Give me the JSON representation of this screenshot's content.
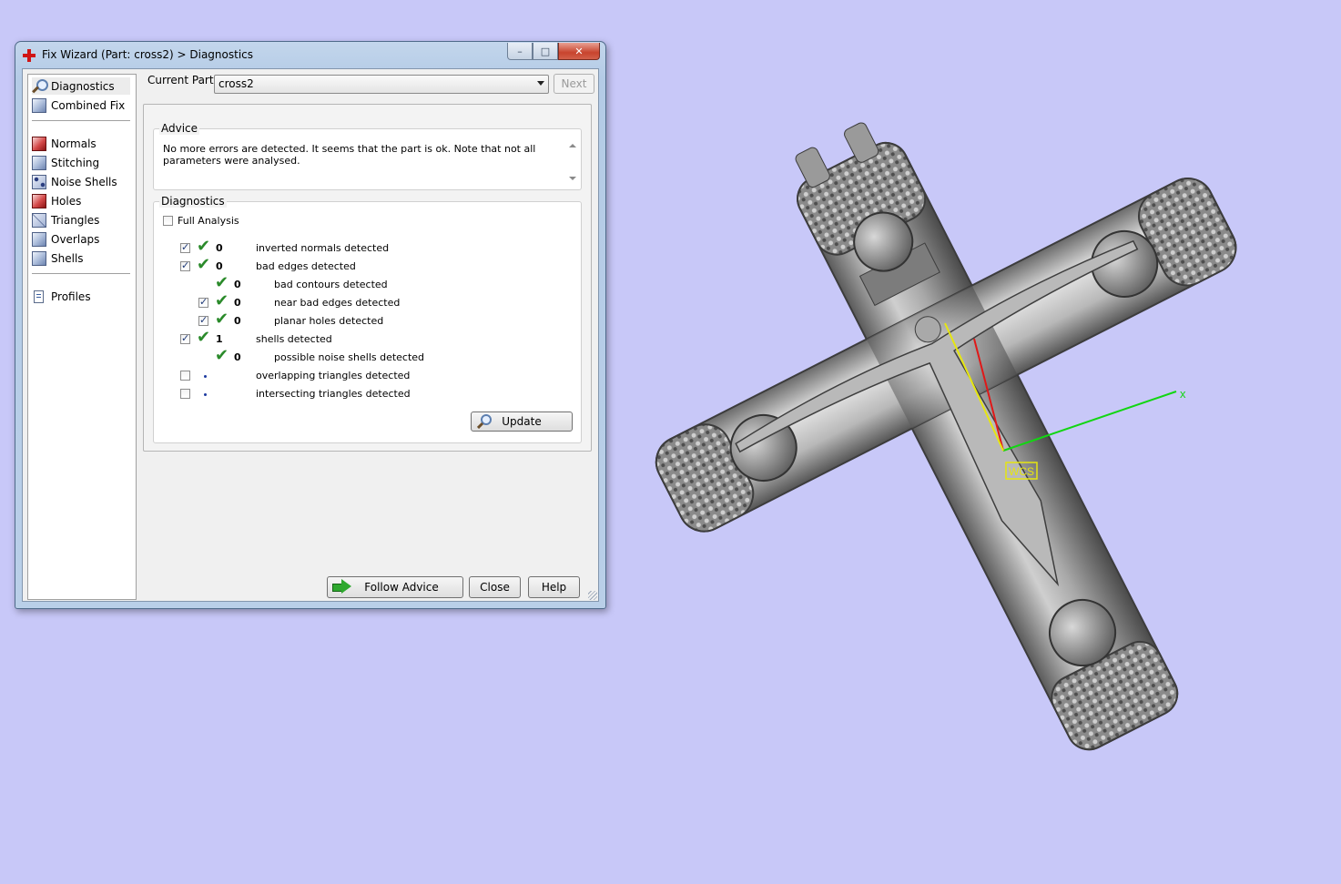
{
  "window": {
    "title": "Fix Wizard (Part: cross2) > Diagnostics",
    "buttons": {
      "minimize": "–",
      "maximize": "□",
      "close": "✕"
    }
  },
  "nav": {
    "items": [
      {
        "label": "Diagnostics",
        "icon": "magnifier-icon",
        "selected": true
      },
      {
        "label": "Combined Fix",
        "icon": "cube-icon"
      },
      {
        "label": "Normals",
        "icon": "red-cube-icon"
      },
      {
        "label": "Stitching",
        "icon": "cube-icon"
      },
      {
        "label": "Noise Shells",
        "icon": "dotted-cube-icon"
      },
      {
        "label": "Holes",
        "icon": "red-cube-icon"
      },
      {
        "label": "Triangles",
        "icon": "wire-cube-icon"
      },
      {
        "label": "Overlaps",
        "icon": "cube-icon"
      },
      {
        "label": "Shells",
        "icon": "cube-icon"
      },
      {
        "label": "Profiles",
        "icon": "document-icon"
      }
    ]
  },
  "part": {
    "label": "Current Part:",
    "value": "cross2",
    "next": "Next"
  },
  "advice": {
    "title": "Advice",
    "text": "No more errors are detected. It seems that the part is ok. Note that not all parameters were analysed."
  },
  "diagnostics": {
    "title": "Diagnostics",
    "full_analysis": "Full Analysis",
    "rows": [
      {
        "count": "0",
        "label": "inverted normals detected",
        "checked": true,
        "ok": true
      },
      {
        "count": "0",
        "label": "bad edges detected",
        "checked": true,
        "ok": true
      },
      {
        "count": "0",
        "label": "bad contours detected",
        "checked": null,
        "ok": true
      },
      {
        "count": "0",
        "label": "near bad edges detected",
        "checked": true,
        "ok": true
      },
      {
        "count": "0",
        "label": "planar holes detected",
        "checked": true,
        "ok": true
      },
      {
        "count": "1",
        "label": "shells detected",
        "checked": true,
        "ok": true
      },
      {
        "count": "0",
        "label": "possible noise shells detected",
        "checked": null,
        "ok": true
      },
      {
        "count": "",
        "label": "overlapping triangles detected",
        "checked": false,
        "ok": false
      },
      {
        "count": "",
        "label": "intersecting triangles detected",
        "checked": false,
        "ok": false
      }
    ],
    "update": "Update"
  },
  "footer": {
    "follow_advice": "Follow Advice",
    "close": "Close",
    "help": "Help"
  },
  "viewport": {
    "axis_x": "x",
    "wcs": "WCS",
    "background": "#c8c8f8"
  }
}
